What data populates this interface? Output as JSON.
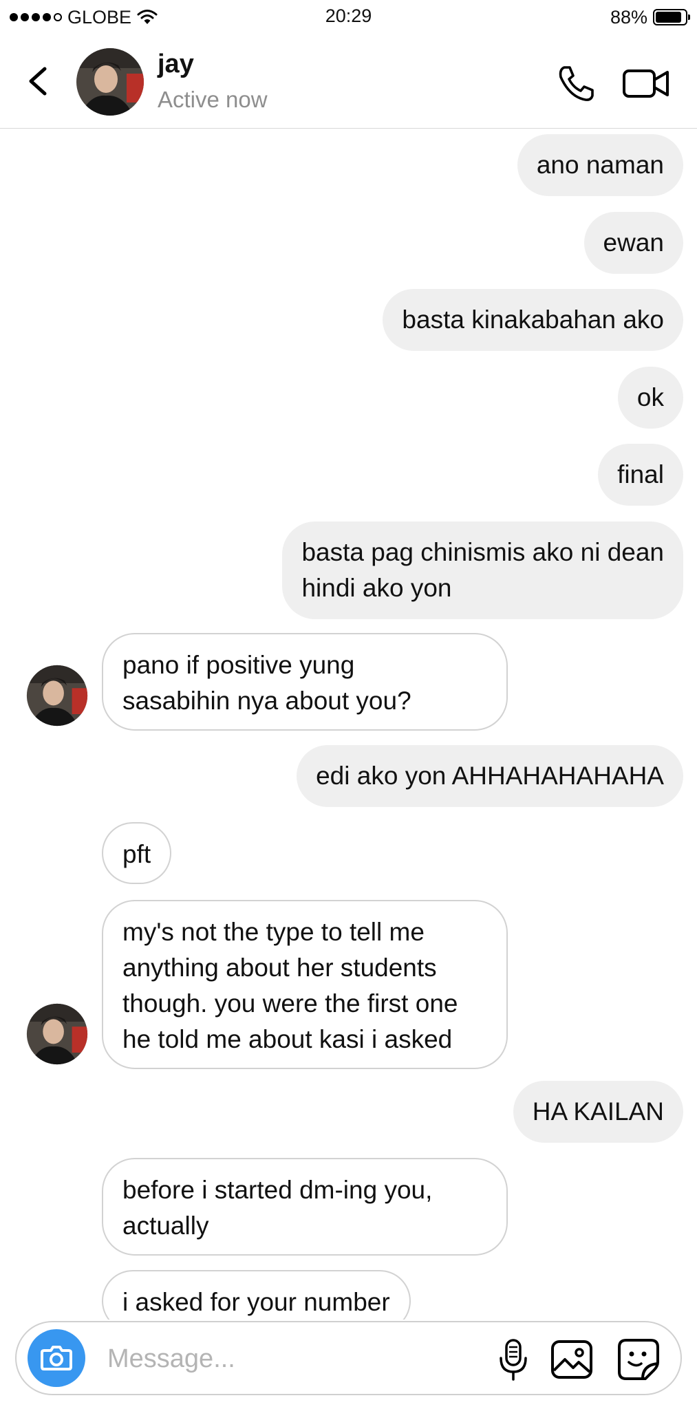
{
  "status_bar": {
    "carrier": "GLOBE",
    "time": "20:29",
    "battery": "88%",
    "battery_level": 0.88,
    "signal_bars": 4,
    "icons": [
      "signal-dots-icon",
      "wifi-icon",
      "battery-icon"
    ]
  },
  "header": {
    "name": "jay",
    "status": "Active now",
    "icons": [
      "back-chevron-icon",
      "phone-icon",
      "video-camera-icon"
    ]
  },
  "messages": [
    {
      "sender": "me",
      "lines": [
        "ano naman"
      ]
    },
    {
      "sender": "me",
      "lines": [
        "ewan"
      ]
    },
    {
      "sender": "me",
      "lines": [
        "basta kinakabahan ako"
      ]
    },
    {
      "sender": "me",
      "lines": [
        "ok"
      ]
    },
    {
      "sender": "me",
      "lines": [
        "final"
      ]
    },
    {
      "sender": "me",
      "lines": [
        "basta pag chinismis ako ni dean",
        "hindi ako yon"
      ]
    },
    {
      "sender": "jay",
      "lines": [
        "pano if positive yung",
        "sasabihin nya about you?"
      ]
    },
    {
      "sender": "me",
      "lines": [
        "edi ako yon AHHAHAHAHAHA"
      ]
    },
    {
      "sender": "jay",
      "lines": [
        "pft"
      ]
    },
    {
      "sender": "jay",
      "lines": [
        "my's not the type to tell me",
        "anything about her students",
        "though. you were the first one",
        "he told me about kasi i asked"
      ]
    },
    {
      "sender": "me",
      "lines": [
        "HA KAILAN"
      ]
    },
    {
      "sender": "jay",
      "lines": [
        "before i started dm-ing you,",
        "actually"
      ]
    },
    {
      "sender": "jay",
      "lines": [
        "i asked for your number"
      ]
    }
  ],
  "composer": {
    "placeholder": "Message...",
    "icons": [
      "camera-icon",
      "microphone-icon",
      "gallery-icon",
      "sticker-icon"
    ]
  },
  "colors": {
    "outgoing_bubble": "#efefef",
    "incoming_border": "#d2d2d2",
    "camera_button": "#3897f0",
    "secondary_text": "#8e8e8e"
  }
}
